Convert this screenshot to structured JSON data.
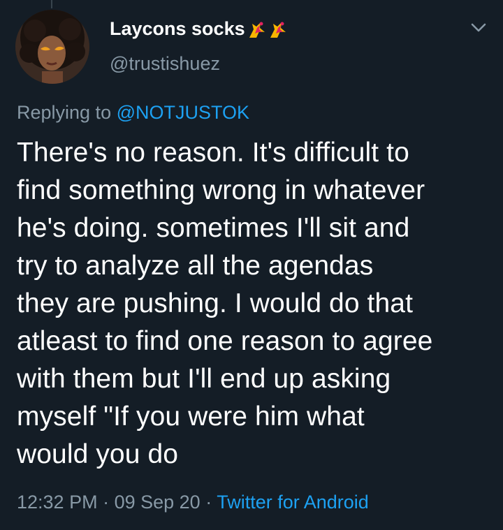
{
  "author": {
    "display_name": "Laycons socks",
    "emojis": [
      "dancer-flames-emoji",
      "dancer-flames-emoji"
    ],
    "handle": "@trustishuez"
  },
  "reply": {
    "prefix": "Replying to ",
    "mention": "@NOTJUSTOK"
  },
  "tweet": {
    "lines": [
      "There's no reason. It's difficult to",
      "find something wrong in whatever",
      "he's doing. sometimes I'll sit and",
      "try to analyze all the agendas",
      "they are pushing. I would do that",
      "atleast to find one reason to agree",
      "with them but I'll end up asking",
      "myself \"If you were him what",
      "would you do"
    ]
  },
  "meta": {
    "time": "12:32 PM",
    "sep1": " · ",
    "date": "09 Sep 20",
    "sep2": " · ",
    "source": "Twitter for Android"
  },
  "colors": {
    "background": "#141d26",
    "text": "#ffffff",
    "muted": "#8899a6",
    "link": "#1da1f2"
  }
}
